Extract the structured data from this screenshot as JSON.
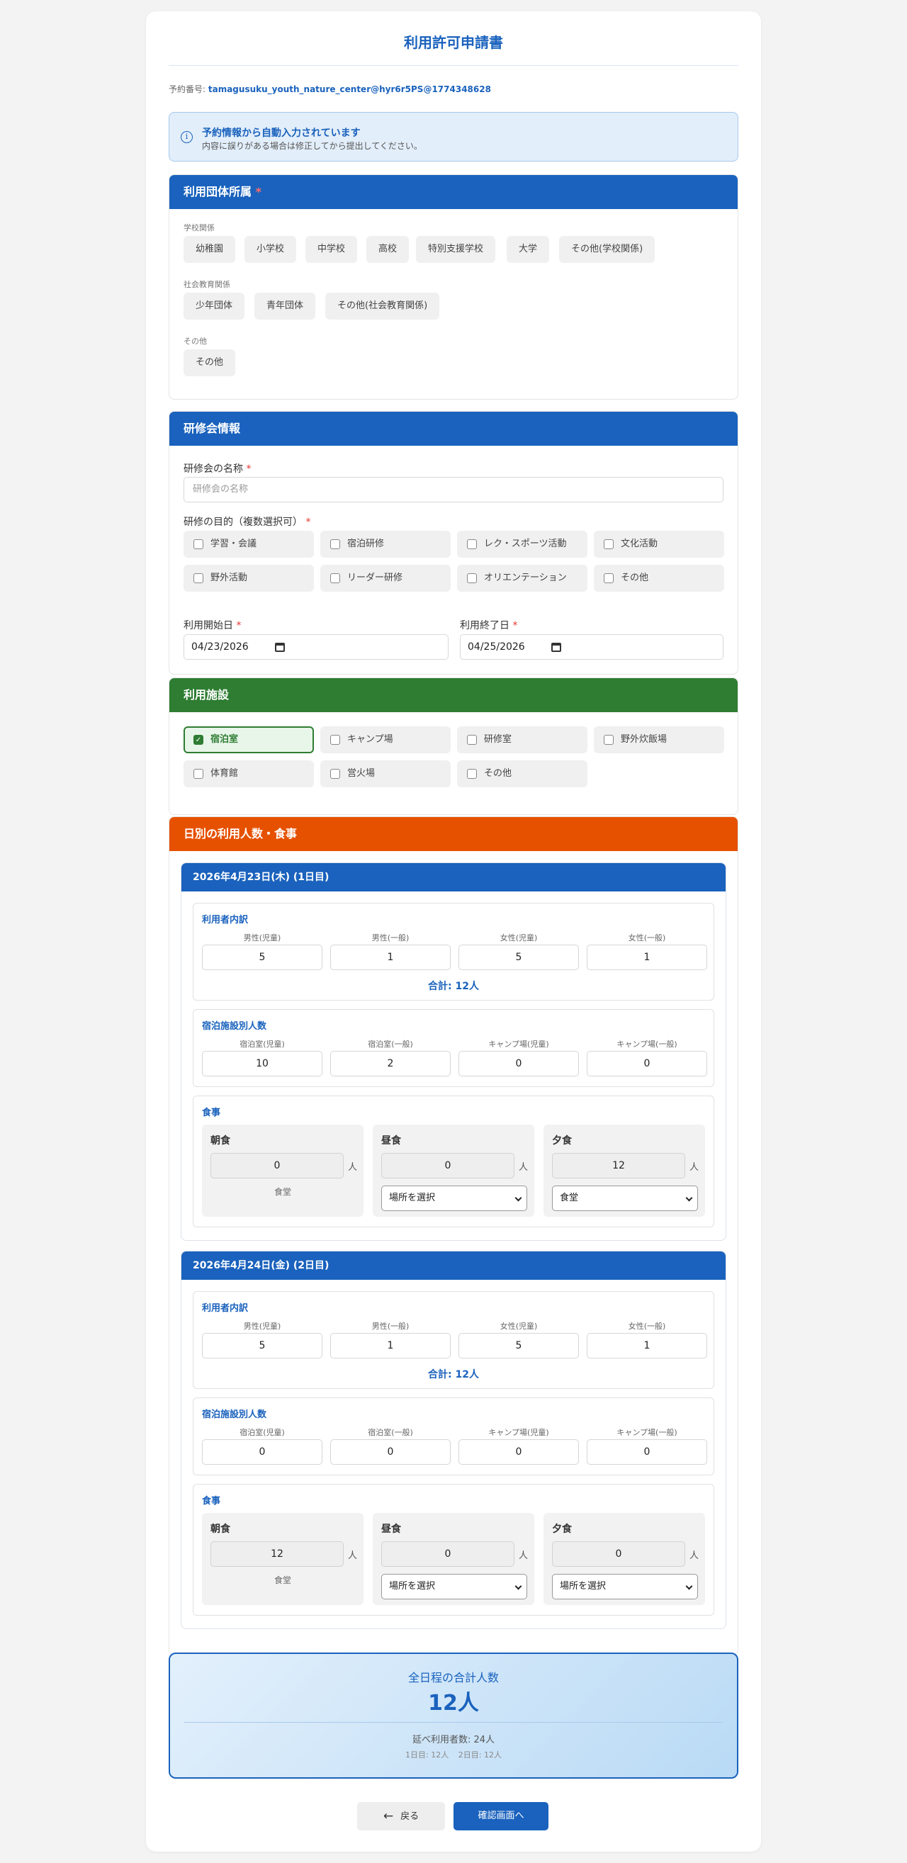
{
  "title": "利用許可申請書",
  "reservation": {
    "label": "予約番号:",
    "value": "tamagusuku_youth_nature_center@hyr6r5PS@1774348628"
  },
  "notice": {
    "title": "予約情報から自動入力されています",
    "text": "内容に誤りがある場合は修正してから提出してください。"
  },
  "organization": {
    "heading": "利用団体所属",
    "required_mark": "*",
    "groups": [
      {
        "label": "学校関係",
        "options": [
          "幼稚園",
          "小学校",
          "中学校",
          "高校",
          "特別支援学校",
          "大学",
          "その他(学校関係)"
        ]
      },
      {
        "label": "社会教育関係",
        "options": [
          "少年団体",
          "青年団体",
          "その他(社会教育関係)"
        ]
      },
      {
        "label": "その他",
        "options": [
          "その他"
        ]
      }
    ]
  },
  "training": {
    "heading": "研修会情報",
    "name_label": "研修会の名称",
    "name_placeholder": "研修会の名称",
    "purpose_label": "研修の目的（複数選択可）",
    "purposes": [
      "学習・会議",
      "宿泊研修",
      "レク・スポーツ活動",
      "文化活動",
      "野外活動",
      "リーダー研修",
      "オリエンテーション",
      "その他"
    ],
    "start_label": "利用開始日",
    "start_value": "04/23/2026",
    "end_label": "利用終了日",
    "end_value": "04/25/2026"
  },
  "facilities": {
    "heading": "利用施設",
    "items": [
      {
        "label": "宿泊室",
        "checked": true
      },
      {
        "label": "キャンプ場",
        "checked": false
      },
      {
        "label": "研修室",
        "checked": false
      },
      {
        "label": "野外炊飯場",
        "checked": false
      },
      {
        "label": "体育館",
        "checked": false
      },
      {
        "label": "営火場",
        "checked": false
      },
      {
        "label": "その他",
        "checked": false
      }
    ]
  },
  "daily": {
    "heading": "日別の利用人数・食事",
    "days": [
      {
        "title": "2026年4月23日(木) (1日目)",
        "users_title": "利用者内訳",
        "users": [
          {
            "label": "男性(児童)",
            "value": "5"
          },
          {
            "label": "男性(一般)",
            "value": "1"
          },
          {
            "label": "女性(児童)",
            "value": "5"
          },
          {
            "label": "女性(一般)",
            "value": "1"
          }
        ],
        "total": "合計: 12人",
        "lodging_title": "宿泊施設別人数",
        "lodging": [
          {
            "label": "宿泊室(児童)",
            "value": "10"
          },
          {
            "label": "宿泊室(一般)",
            "value": "2"
          },
          {
            "label": "キャンプ場(児童)",
            "value": "0"
          },
          {
            "label": "キャンプ場(一般)",
            "value": "0"
          }
        ],
        "meals_title": "食事",
        "meals": [
          {
            "name": "朝食",
            "count": "0",
            "unit": "人",
            "place": "食堂"
          },
          {
            "name": "昼食",
            "count": "0",
            "unit": "人",
            "select": "場所を選択"
          },
          {
            "name": "夕食",
            "count": "12",
            "unit": "人",
            "select": "食堂"
          }
        ]
      },
      {
        "title": "2026年4月24日(金) (2日目)",
        "users_title": "利用者内訳",
        "users": [
          {
            "label": "男性(児童)",
            "value": "5"
          },
          {
            "label": "男性(一般)",
            "value": "1"
          },
          {
            "label": "女性(児童)",
            "value": "5"
          },
          {
            "label": "女性(一般)",
            "value": "1"
          }
        ],
        "total": "合計: 12人",
        "lodging_title": "宿泊施設別人数",
        "lodging": [
          {
            "label": "宿泊室(児童)",
            "value": "0"
          },
          {
            "label": "宿泊室(一般)",
            "value": "0"
          },
          {
            "label": "キャンプ場(児童)",
            "value": "0"
          },
          {
            "label": "キャンプ場(一般)",
            "value": "0"
          }
        ],
        "meals_title": "食事",
        "meals": [
          {
            "name": "朝食",
            "count": "12",
            "unit": "人",
            "place": "食堂"
          },
          {
            "name": "昼食",
            "count": "0",
            "unit": "人",
            "select": "場所を選択"
          },
          {
            "name": "夕食",
            "count": "0",
            "unit": "人",
            "select": "場所を選択"
          }
        ]
      }
    ]
  },
  "summary": {
    "title": "全日程の合計人数",
    "total": "12人",
    "cumulative": "延べ利用者数: 24人",
    "breakdown": [
      "1日目: 12人",
      "2日目: 12人"
    ]
  },
  "buttons": {
    "back": "戻る",
    "next": "確認画面へ"
  },
  "icons": {
    "info": "info-icon",
    "back": "arrow-left-icon",
    "calendar": "calendar-icon",
    "check": "check-icon",
    "dropdown": "chevron-down-icon"
  },
  "colors": {
    "primary": "#1a62bd",
    "facility": "#2e7d32",
    "daily": "#e65100",
    "required": "#e53935"
  }
}
